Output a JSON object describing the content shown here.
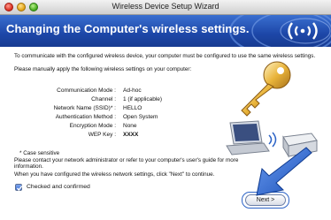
{
  "window": {
    "title": "Wireless Device Setup Wizard"
  },
  "banner": {
    "title": "Changing the Computer's wireless settings."
  },
  "intro": {
    "line1": "To communicate with the configured wireless device, your computer must be configured to use the same wireless settings.",
    "line2": "Please manually apply the following wireless settings on your computer:"
  },
  "settings": [
    {
      "label": "Communication Mode :",
      "value": "Ad-hoc"
    },
    {
      "label": "Channel :",
      "value": "1   (if applicable)"
    },
    {
      "label": "Network Name (SSID)* :",
      "value": "HELLO"
    },
    {
      "label": "Authentication Method :",
      "value": "Open System"
    },
    {
      "label": "Encryption Mode :",
      "value": "None"
    },
    {
      "label": "WEP Key :",
      "value": "XXXX"
    }
  ],
  "case_note": "* Case sensitive",
  "contact_text": "Please contact your network administrator or refer to your computer's user's guide for more information.",
  "next_instruction": "When you have configured the wireless network settings, click \"Next\" to continue.",
  "confirm": {
    "label": "Checked and confirmed",
    "checked": true
  },
  "buttons": {
    "next": "Next >"
  },
  "icons": {
    "key": "key-icon",
    "laptop": "laptop-icon",
    "printer": "printer-icon",
    "wireless": "wireless-icon",
    "arrow": "pointer-arrow-icon"
  },
  "colors": {
    "banner": "#1d47a8",
    "accent": "#2c63c6",
    "key": "#e7b43a"
  }
}
